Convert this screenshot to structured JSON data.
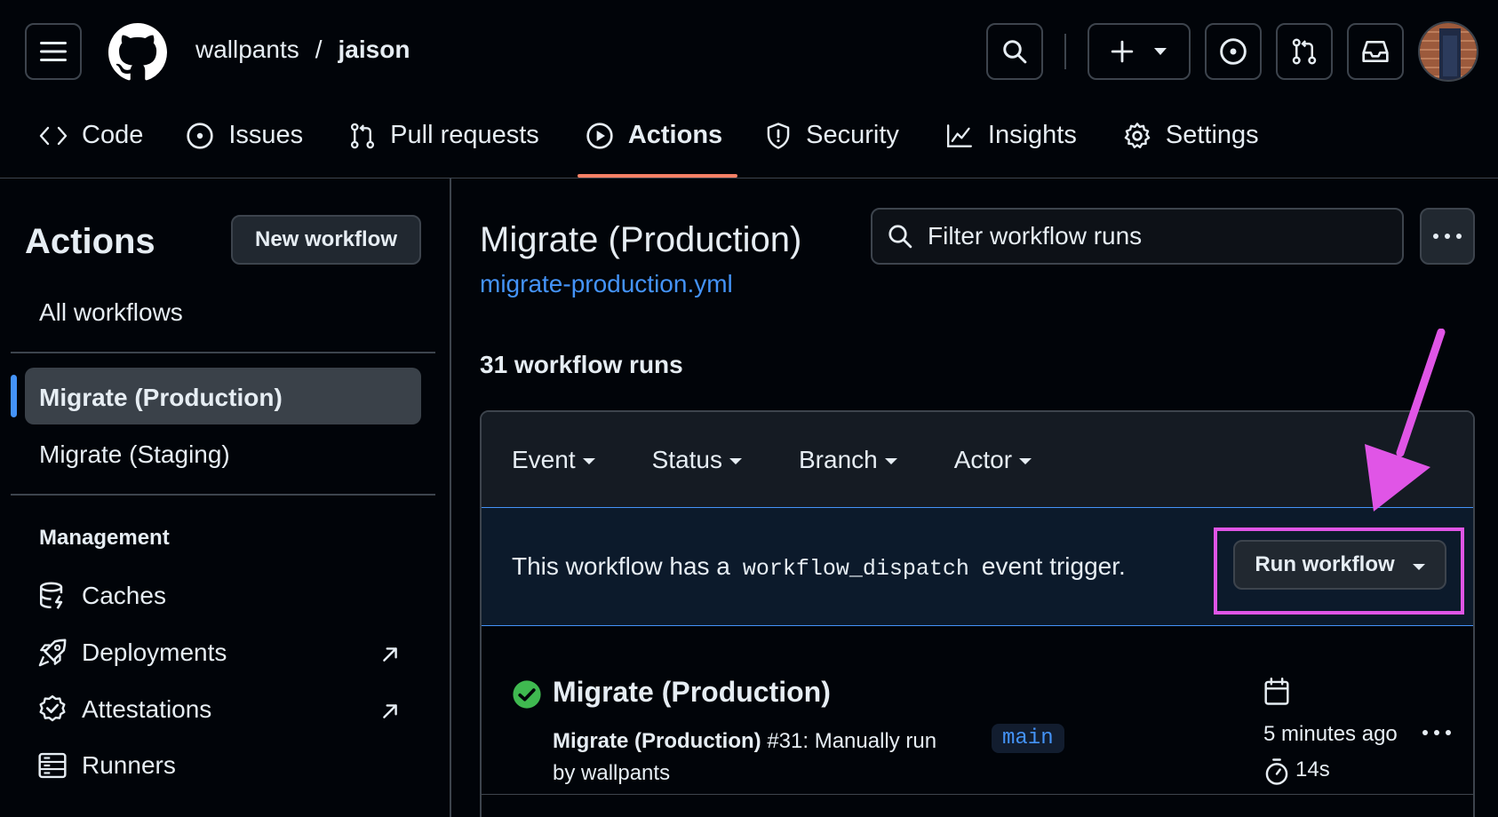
{
  "header": {
    "owner": "wallpants",
    "separator": "/",
    "repo": "jaison"
  },
  "tabs": [
    {
      "label": "Code",
      "icon": "code-icon"
    },
    {
      "label": "Issues",
      "icon": "issue-opened-icon"
    },
    {
      "label": "Pull requests",
      "icon": "git-pull-request-icon"
    },
    {
      "label": "Actions",
      "icon": "play-icon",
      "active": true
    },
    {
      "label": "Security",
      "icon": "shield-icon"
    },
    {
      "label": "Insights",
      "icon": "graph-icon"
    },
    {
      "label": "Settings",
      "icon": "gear-icon"
    }
  ],
  "sidebar": {
    "title": "Actions",
    "new_workflow_label": "New workflow",
    "all_workflows": "All workflows",
    "workflows": [
      {
        "label": "Migrate (Production)",
        "active": true
      },
      {
        "label": "Migrate (Staging)",
        "active": false
      }
    ],
    "management_heading": "Management",
    "management": [
      {
        "label": "Caches",
        "icon": "database-icon"
      },
      {
        "label": "Deployments",
        "icon": "rocket-icon",
        "external": true
      },
      {
        "label": "Attestations",
        "icon": "verified-icon",
        "external": true
      },
      {
        "label": "Runners",
        "icon": "server-icon"
      }
    ]
  },
  "main": {
    "title": "Migrate (Production)",
    "file": "migrate-production.yml",
    "filter_placeholder": "Filter workflow runs",
    "runs_count": "31 workflow runs",
    "filters": [
      "Event",
      "Status",
      "Branch",
      "Actor"
    ],
    "dispatch": {
      "prefix": "This workflow has a",
      "code": "workflow_dispatch",
      "suffix": "event trigger.",
      "button": "Run workflow"
    },
    "runs": [
      {
        "status": "success",
        "title": "Migrate (Production)",
        "meta_name": "Migrate (Production)",
        "meta_rest": "#31: Manually run by wallpants",
        "branch": "main",
        "time_ago": "5 minutes ago",
        "duration": "14s"
      }
    ]
  },
  "colors": {
    "background": "#010409",
    "border": "#3d444d",
    "link": "#4493f8",
    "tab_underline": "#f78166",
    "success": "#3fb950",
    "annotation": "#e055e6"
  }
}
